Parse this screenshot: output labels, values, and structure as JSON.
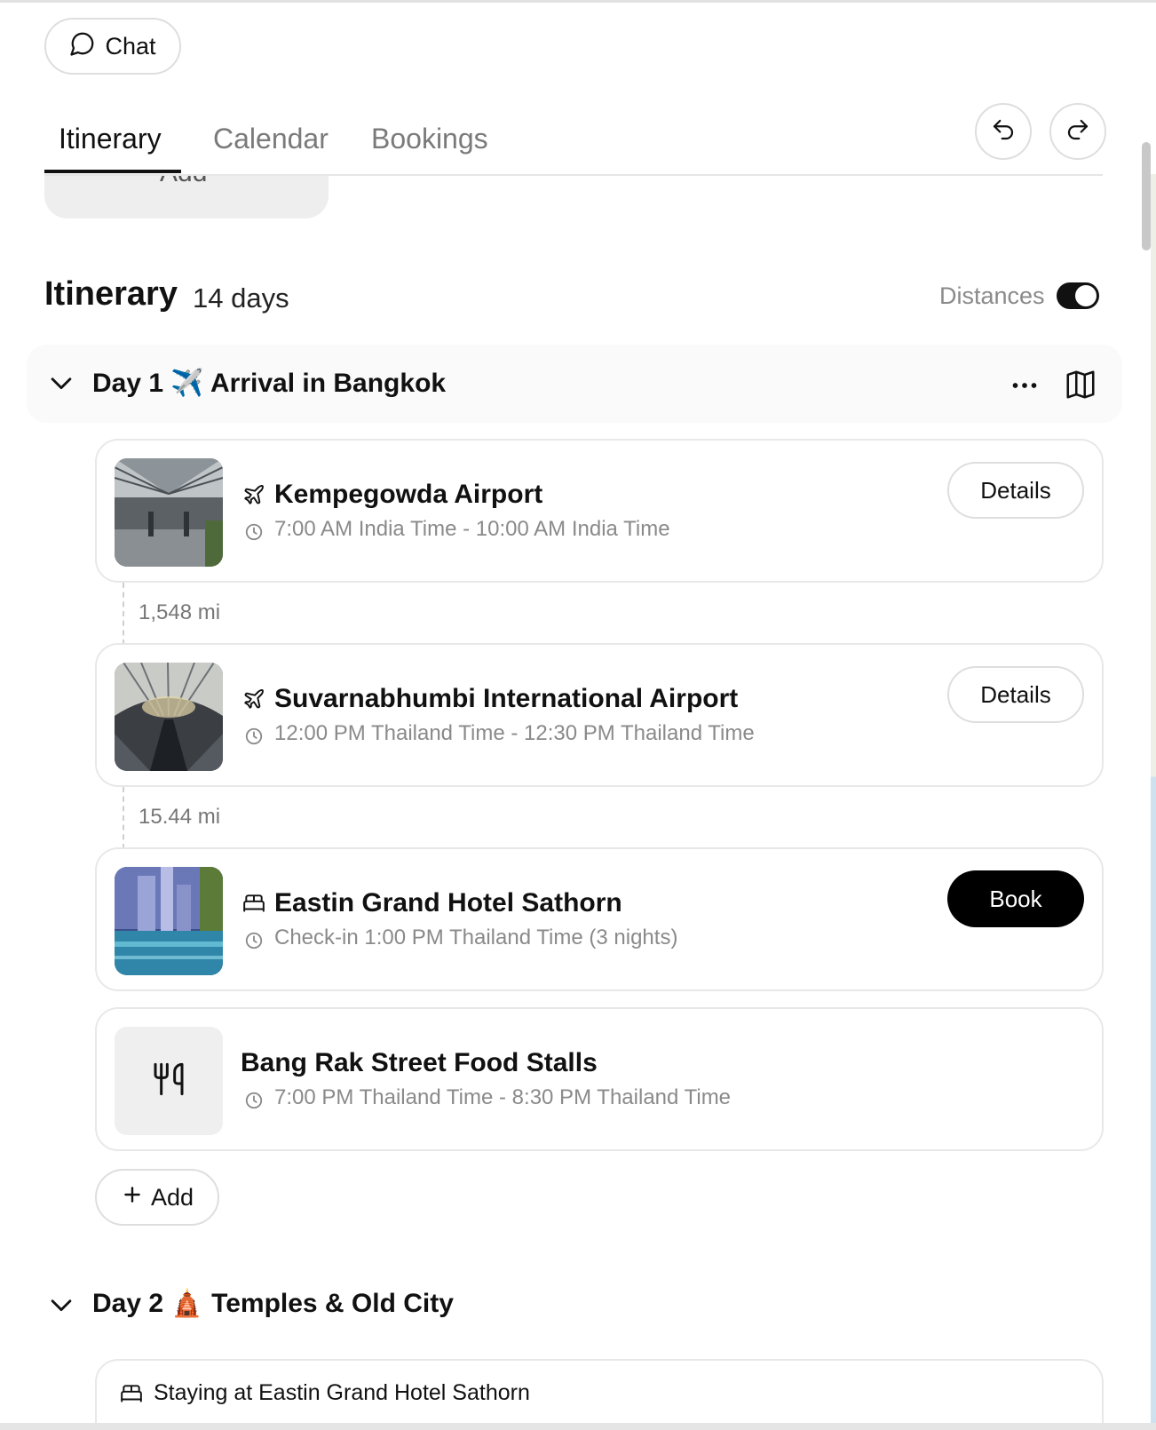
{
  "header": {
    "chat_label": "Chat"
  },
  "tabs": [
    {
      "label": "Itinerary",
      "active": true
    },
    {
      "label": "Calendar",
      "active": false
    },
    {
      "label": "Bookings",
      "active": false
    }
  ],
  "partial_card_label": "Add",
  "itinerary": {
    "title": "Itinerary",
    "days_label": "14 days",
    "distances_label": "Distances",
    "distances_on": true
  },
  "day1": {
    "day_label": "Day 1",
    "emoji": "✈️",
    "title": "Arrival in Bangkok",
    "items": [
      {
        "name": "Kempegowda Airport",
        "time": "7:00 AM India Time - 10:00 AM India Time",
        "type_icon": "plane-icon",
        "action": "Details"
      },
      {
        "name": "Suvarnabhumbi International Airport",
        "time": "12:00 PM Thailand Time - 12:30 PM Thailand Time",
        "type_icon": "plane-icon",
        "action": "Details"
      },
      {
        "name": "Eastin Grand Hotel Sathorn",
        "time": "Check-in 1:00 PM Thailand Time (3 nights)",
        "type_icon": "bed-icon",
        "action": "Book"
      },
      {
        "name": "Bang Rak Street Food Stalls",
        "time": "7:00 PM Thailand Time - 8:30 PM Thailand Time",
        "type_icon": "utensils-icon"
      }
    ],
    "distances": [
      "1,548 mi",
      "15.44 mi"
    ],
    "add_label": "Add"
  },
  "day2": {
    "day_label": "Day 2",
    "emoji": "🛕",
    "title": "Temples & Old City",
    "staying_text": "Staying at Eastin Grand Hotel Sathorn"
  },
  "colors": {
    "accent": "#111111",
    "muted": "#8a8a8a",
    "border": "#e8e8e8",
    "book_bg": "#000000"
  }
}
